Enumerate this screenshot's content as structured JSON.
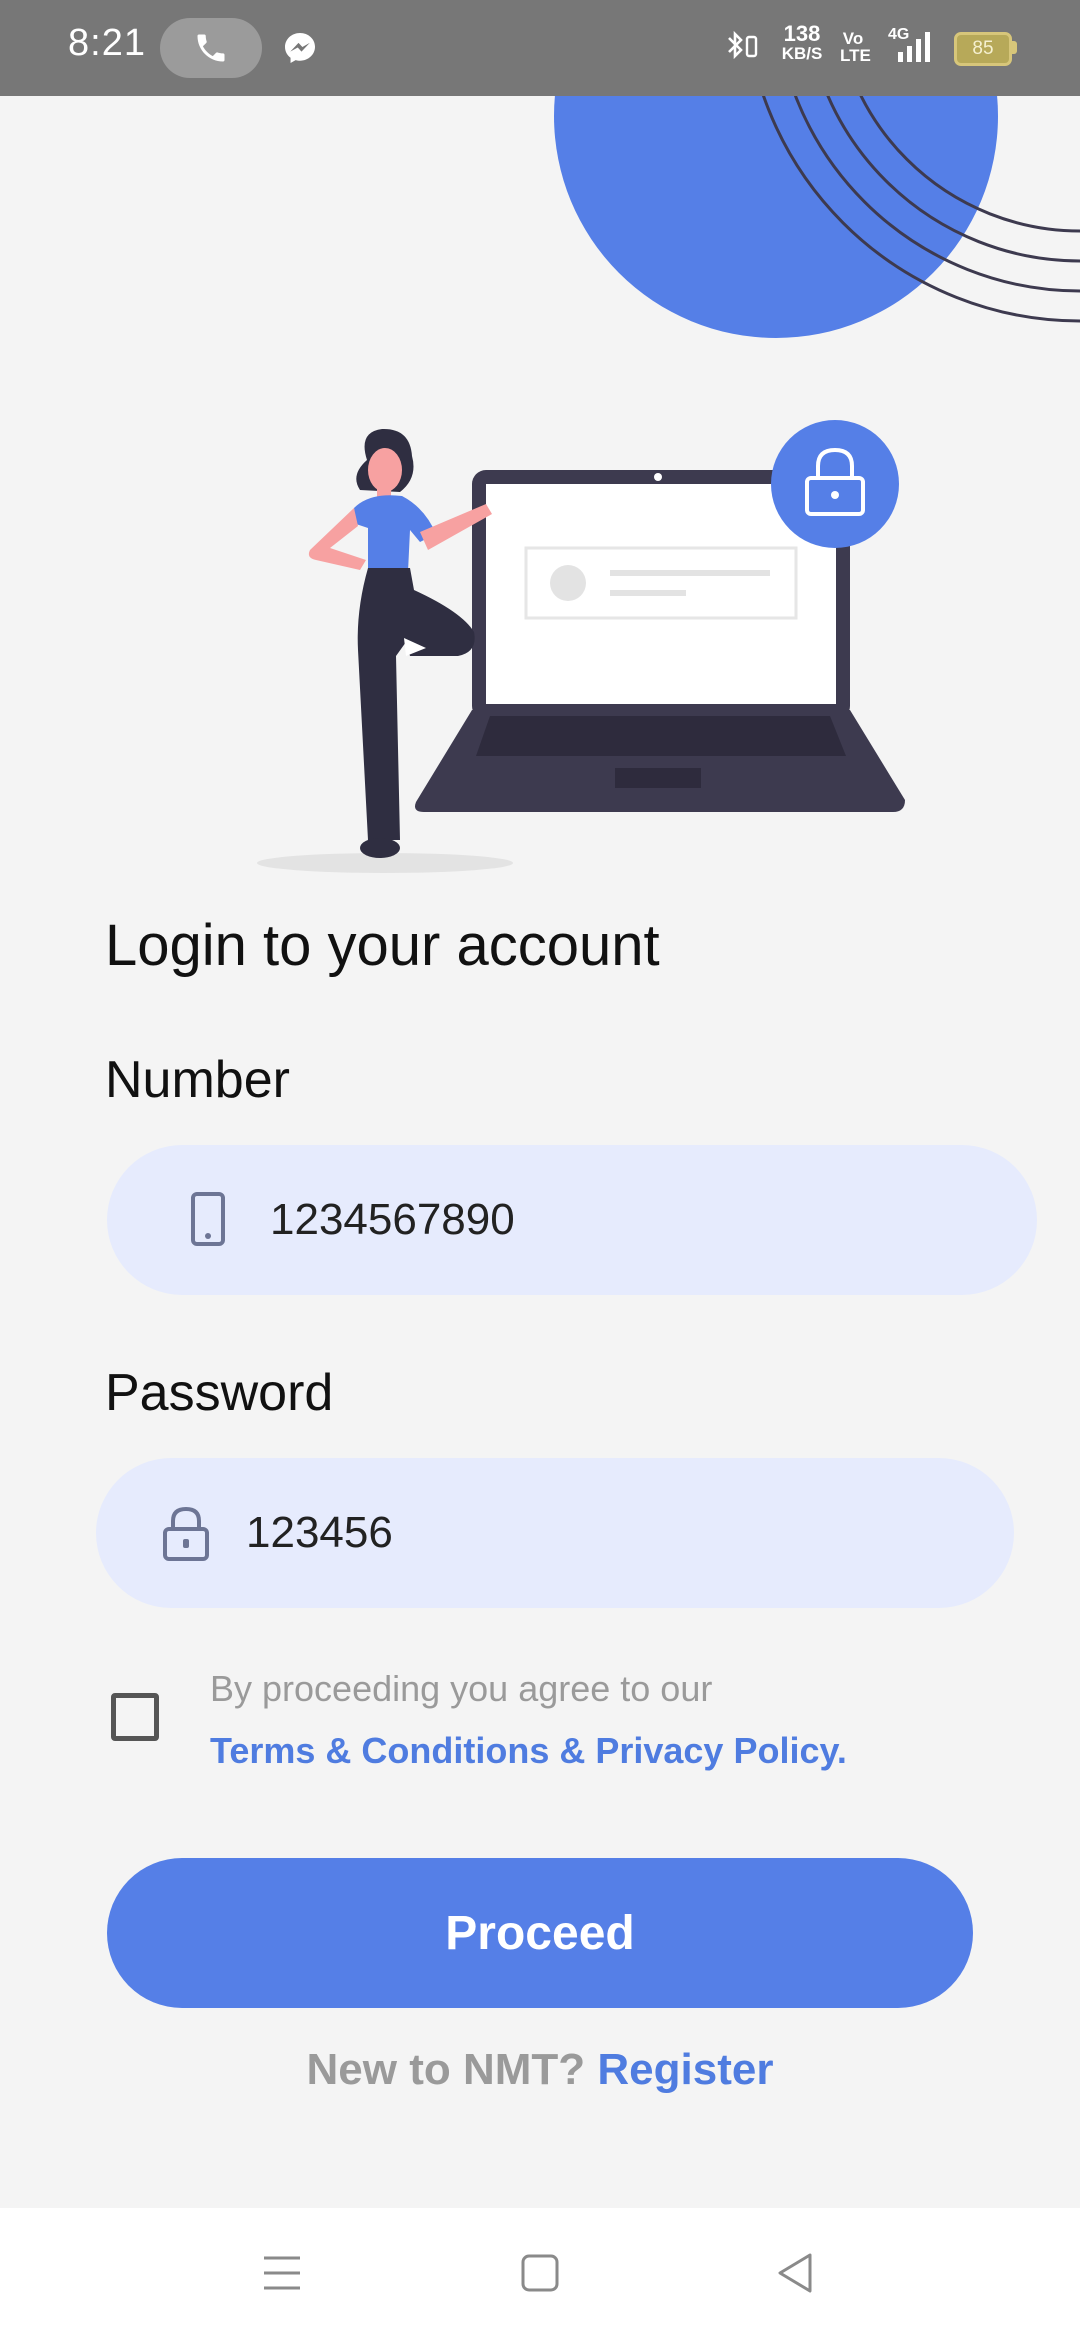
{
  "status_bar": {
    "time": "8:21",
    "net_speed": "138",
    "net_speed_unit": "KB/S",
    "volte": "Vo LTE",
    "network": "4G",
    "battery": "85",
    "icons": [
      "phone-call-icon",
      "messenger-icon",
      "bluetooth-icon",
      "signal-icon",
      "battery-icon"
    ]
  },
  "login": {
    "title": "Login to your account",
    "number_label": "Number",
    "number_value": "1234567890",
    "password_label": "Password",
    "password_value": "123456",
    "agree_text": "By proceeding you agree to our",
    "terms_link": "Terms & Conditions & Privacy Policy.",
    "proceed_label": "Proceed",
    "new_user_text": "New to NMT?",
    "register_link": "Register"
  },
  "colors": {
    "accent": "#557fe7",
    "field_bg": "#e6ebfd",
    "background": "#f4f4f4",
    "dark": "#3d3a4f"
  },
  "nav_bar": {
    "icons": [
      "menu-icon",
      "home-icon",
      "back-icon"
    ]
  }
}
